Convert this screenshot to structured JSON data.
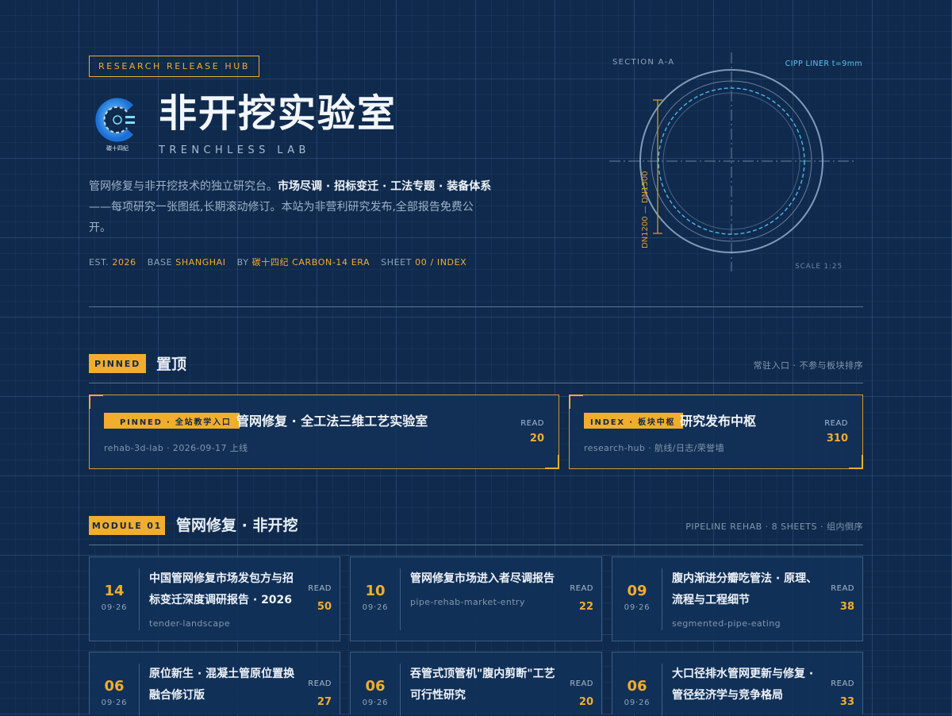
{
  "header": {
    "hub_tag": "RESEARCH RELEASE HUB",
    "logo_caption": "碳十四纪",
    "title": "非开挖实验室",
    "subtitle": "TRENCHLESS LAB",
    "description": {
      "lead": "管网修复与非开挖技术的独立研究台。",
      "bold_1": "市场尽调 · 招标变迁 · 工法专题 · 装备",
      "bold_2": "体系",
      "tail": "——每项研究一张图纸,长期滚动修订。本站为非营利研究发布,全部报告免费公开。"
    },
    "meta": {
      "est_label": "EST.",
      "est_value": "2026",
      "base_label": "BASE",
      "base_value": "SHANGHAI",
      "by_label": "BY",
      "by_value": "碳十四纪 CARBON-14 ERA",
      "sheet_label": "SHEET",
      "sheet_value": "00 / INDEX"
    }
  },
  "section_drawing": {
    "section_label": "SECTION A-A",
    "liner_label": "CIPP LINER t=9mm",
    "dimension_label": "DN1200 — DN1500",
    "scale_label": "SCALE 1:25",
    "colors": {
      "line": "#8ea6c3",
      "liner": "#4fb6ee",
      "dimension": "#e0a030"
    }
  },
  "pinned": {
    "pill": "PINNED",
    "title": "置顶",
    "note": "常驻入口 · 不参与板块排序",
    "cards": [
      {
        "tag": "PINNED · 全站教学入口",
        "title": "管网修复 · 全工法三维工艺实验室",
        "sub": "rehab-3d-lab · 2026-09-17 上线",
        "read_label": "READ",
        "read": "20"
      },
      {
        "tag": "INDEX · 板块中枢",
        "title": "研究发布中枢",
        "sub": "research-hub · 航线/日志/荣誉墙",
        "read_label": "READ",
        "read": "310"
      }
    ]
  },
  "module01": {
    "pill": "MODULE 01",
    "title": "管网修复 · 非开挖",
    "note": "PIPELINE REHAB · 8 SHEETS · 组内倒序",
    "cards": [
      {
        "day": "14",
        "date": "09·26",
        "title": "中国管网修复市场发包方与招标变迁深度调研报告 · 2026",
        "slug": "tender-landscape",
        "read_label": "READ",
        "read": "50"
      },
      {
        "day": "10",
        "date": "09·26",
        "title": "管网修复市场进入者尽调报告",
        "slug": "pipe-rehab-market-entry",
        "read_label": "READ",
        "read": "22"
      },
      {
        "day": "09",
        "date": "09·26",
        "title": "腹内渐进分瓣吃管法 · 原理、流程与工程细节",
        "slug": "segmented-pipe-eating",
        "read_label": "READ",
        "read": "38"
      },
      {
        "day": "06",
        "date": "09·26",
        "title": "原位新生 · 混凝土管原位置换融合修订版",
        "slug": "",
        "read_label": "READ",
        "read": "27"
      },
      {
        "day": "06",
        "date": "09·26",
        "title": "吞管式顶管机\"腹内剪断\"工艺可行性研究",
        "slug": "",
        "read_label": "READ",
        "read": "20"
      },
      {
        "day": "06",
        "date": "09·26",
        "title": "大口径排水管网更新与修复 · 管径经济学与竞争格局",
        "slug": "",
        "read_label": "READ",
        "read": "33"
      }
    ]
  },
  "colors": {
    "background": "#0f2a4c",
    "accent": "#f2ad2c",
    "card": "#133158",
    "text": "#eef3fa"
  }
}
